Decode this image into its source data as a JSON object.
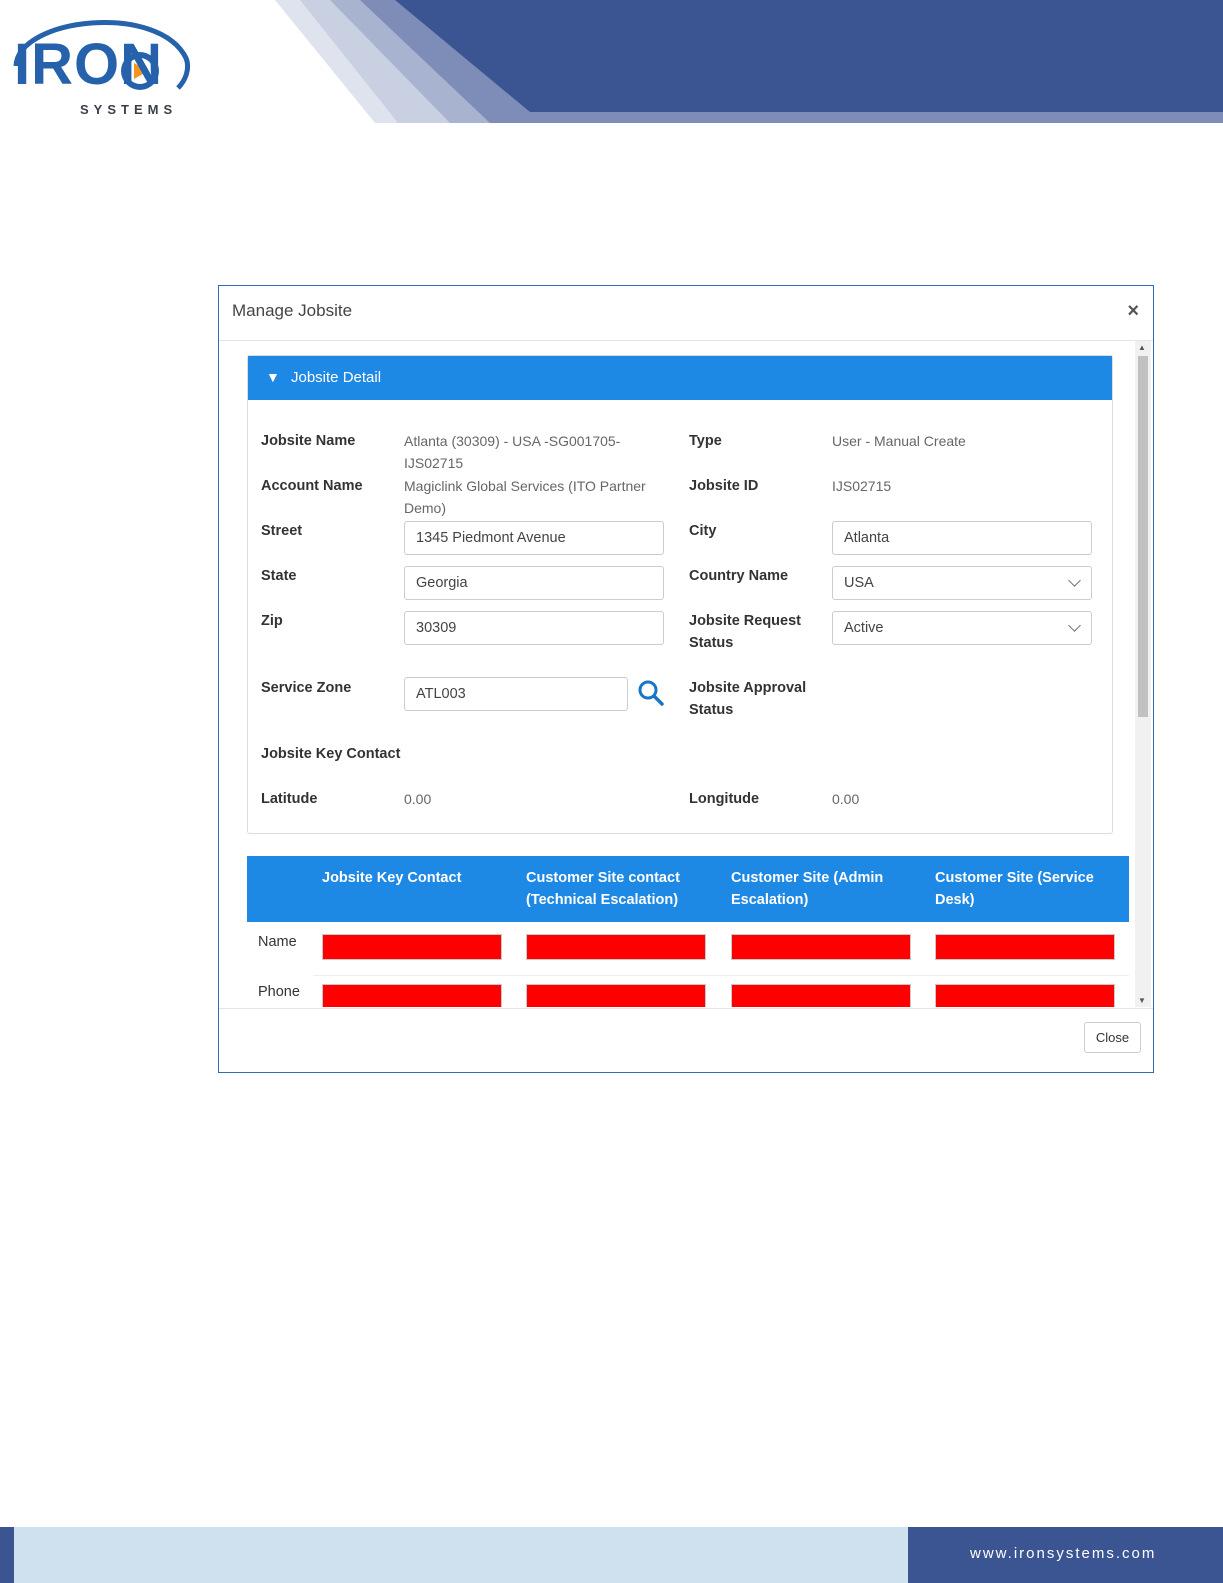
{
  "branding": {
    "logo_text": "IRON",
    "logo_subtext": "SYSTEMS",
    "website": "www.ironsystems.com",
    "colors": {
      "primary_blue": "#3a5591",
      "accent_blue": "#1e88e5",
      "logo_blue": "#2562ab",
      "logo_orange": "#f7941d"
    }
  },
  "modal": {
    "title": "Manage Jobsite",
    "close_icon": "×",
    "close_button": "Close"
  },
  "panel": {
    "arrow_icon": "▼",
    "title": "Jobsite Detail"
  },
  "fields": {
    "jobsite_name_label": "Jobsite Name",
    "jobsite_name_line1": "Atlanta (30309) - USA -SG001705-",
    "jobsite_name_line2": "IJS02715",
    "type_label": "Type",
    "type_value": "User - Manual Create",
    "account_name_label": "Account Name",
    "account_name_line1": "Magiclink Global Services (ITO Partner",
    "account_name_line2": "Demo)",
    "jobsite_id_label": "Jobsite ID",
    "jobsite_id_value": "IJS02715",
    "street_label": "Street",
    "street_value": "1345 Piedmont Avenue",
    "city_label": "City",
    "city_value": "Atlanta",
    "state_label": "State",
    "state_value": "Georgia",
    "country_label": "Country Name",
    "country_value": "USA",
    "zip_label": "Zip",
    "zip_value": "30309",
    "request_status_label_1": "Jobsite Request",
    "request_status_label_2": "Status",
    "request_status_value": "Active",
    "service_zone_label": "Service Zone",
    "service_zone_value": "ATL003",
    "approval_status_label_1": "Jobsite Approval",
    "approval_status_label_2": "Status",
    "key_contact_label": "Jobsite Key Contact",
    "latitude_label": "Latitude",
    "latitude_value": "0.00",
    "longitude_label": "Longitude",
    "longitude_value": "0.00"
  },
  "contacts_table": {
    "headers": [
      {
        "line1": "Jobsite Key Contact",
        "line2": ""
      },
      {
        "line1": "Customer Site contact",
        "line2": "(Technical Escalation)"
      },
      {
        "line1": "Customer Site (Admin",
        "line2": "Escalation)"
      },
      {
        "line1": "Customer Site (Service",
        "line2": "Desk)"
      }
    ],
    "rows": [
      "Name",
      "Phone"
    ]
  }
}
